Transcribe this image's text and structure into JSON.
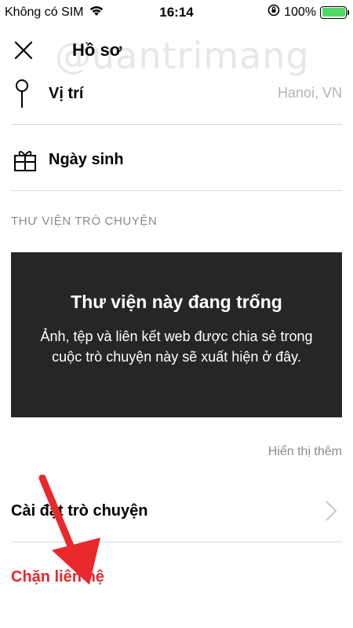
{
  "status_bar": {
    "carrier": "Không có SIM",
    "time": "16:14",
    "battery": "100%",
    "battery_level": 1.0,
    "battery_color": "#4cd964"
  },
  "header": {
    "title": "Hồ sơ",
    "close_icon": "close-icon",
    "watermark": "@uantrimang"
  },
  "profile": {
    "location_label": "Vị trí",
    "location_value": "Hanoi, VN",
    "birthday_label": "Ngày sinh"
  },
  "gallery": {
    "section_title": "THƯ VIỆN TRÒ CHUYỆN",
    "empty_title": "Thư viện này đang trống",
    "empty_description": "Ảnh, tệp và liên kết web được chia sẻ trong cuộc trò chuyện này sẽ xuất hiện ở đây.",
    "show_more": "Hiển thị thêm"
  },
  "settings": {
    "chat_settings_label": "Cài đặt trò chuyện",
    "block_contact_label": "Chặn liên hệ"
  },
  "colors": {
    "danger": "#e8282b",
    "gallery_background": "#262626",
    "muted_text": "#8a8a8a",
    "annotation_arrow": "#e8282b"
  }
}
